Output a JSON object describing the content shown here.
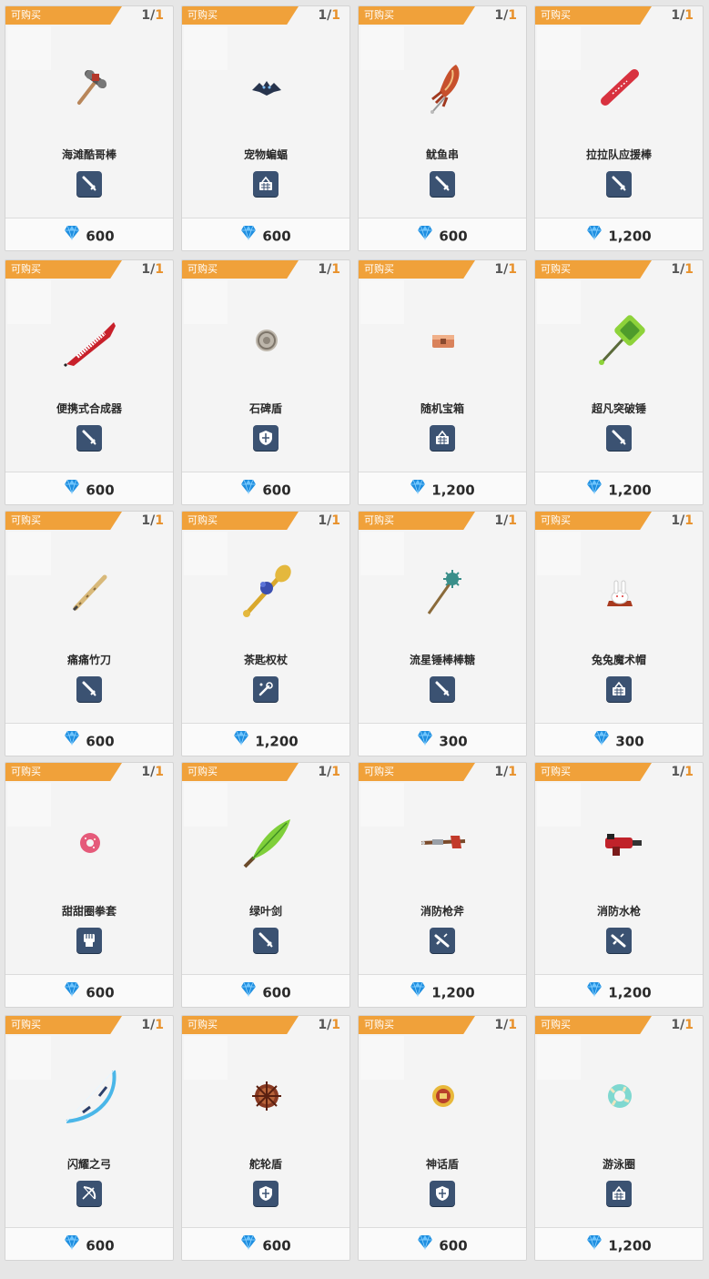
{
  "shop": {
    "buyable_label": "可购买",
    "items": [
      {
        "name": "海滩酷哥棒",
        "type": "sword",
        "price": "600",
        "stock_current": "1",
        "stock_max": "1",
        "art": "hammer"
      },
      {
        "name": "宠物蝙蝠",
        "type": "basket",
        "price": "600",
        "stock_current": "1",
        "stock_max": "1",
        "art": "bat"
      },
      {
        "name": "鱿鱼串",
        "type": "sword",
        "price": "600",
        "stock_current": "1",
        "stock_max": "1",
        "art": "squid"
      },
      {
        "name": "拉拉队应援棒",
        "type": "sword",
        "price": "1,200",
        "stock_current": "1",
        "stock_max": "1",
        "art": "stick"
      },
      {
        "name": "便携式合成器",
        "type": "sword",
        "price": "600",
        "stock_current": "1",
        "stock_max": "1",
        "art": "keytar"
      },
      {
        "name": "石碑盾",
        "type": "shield",
        "price": "600",
        "stock_current": "1",
        "stock_max": "1",
        "art": "stone"
      },
      {
        "name": "随机宝箱",
        "type": "basket",
        "price": "1,200",
        "stock_current": "1",
        "stock_max": "1",
        "art": "chest"
      },
      {
        "name": "超凡突破锤",
        "type": "sword",
        "price": "1,200",
        "stock_current": "1",
        "stock_max": "1",
        "art": "greenhammer"
      },
      {
        "name": "痛痛竹刀",
        "type": "sword",
        "price": "600",
        "stock_current": "1",
        "stock_max": "1",
        "art": "bamboo"
      },
      {
        "name": "茶匙权杖",
        "type": "staff",
        "price": "1,200",
        "stock_current": "1",
        "stock_max": "1",
        "art": "spoon"
      },
      {
        "name": "流星锤棒棒糖",
        "type": "sword",
        "price": "300",
        "stock_current": "1",
        "stock_max": "1",
        "art": "mace"
      },
      {
        "name": "兔兔魔术帽",
        "type": "basket",
        "price": "300",
        "stock_current": "1",
        "stock_max": "1",
        "art": "bunny"
      },
      {
        "name": "甜甜圈拳套",
        "type": "fist",
        "price": "600",
        "stock_current": "1",
        "stock_max": "1",
        "art": "donut"
      },
      {
        "name": "绿叶剑",
        "type": "sword",
        "price": "600",
        "stock_current": "1",
        "stock_max": "1",
        "art": "leaf"
      },
      {
        "name": "消防枪斧",
        "type": "gun",
        "price": "1,200",
        "stock_current": "1",
        "stock_max": "1",
        "art": "axegun"
      },
      {
        "name": "消防水枪",
        "type": "gun",
        "price": "1,200",
        "stock_current": "1",
        "stock_max": "1",
        "art": "watergun"
      },
      {
        "name": "闪耀之弓",
        "type": "bow",
        "price": "600",
        "stock_current": "1",
        "stock_max": "1",
        "art": "bow"
      },
      {
        "name": "舵轮盾",
        "type": "shield",
        "price": "600",
        "stock_current": "1",
        "stock_max": "1",
        "art": "wheel"
      },
      {
        "name": "神话盾",
        "type": "shield",
        "price": "600",
        "stock_current": "1",
        "stock_max": "1",
        "art": "mythshield"
      },
      {
        "name": "游泳圈",
        "type": "basket",
        "price": "1,200",
        "stock_current": "1",
        "stock_max": "1",
        "art": "ring"
      }
    ]
  },
  "colors": {
    "tag": "#f0a13a",
    "stock_max": "#e8912b",
    "badge": "#3b5272",
    "gem": "#1f8fe0"
  }
}
